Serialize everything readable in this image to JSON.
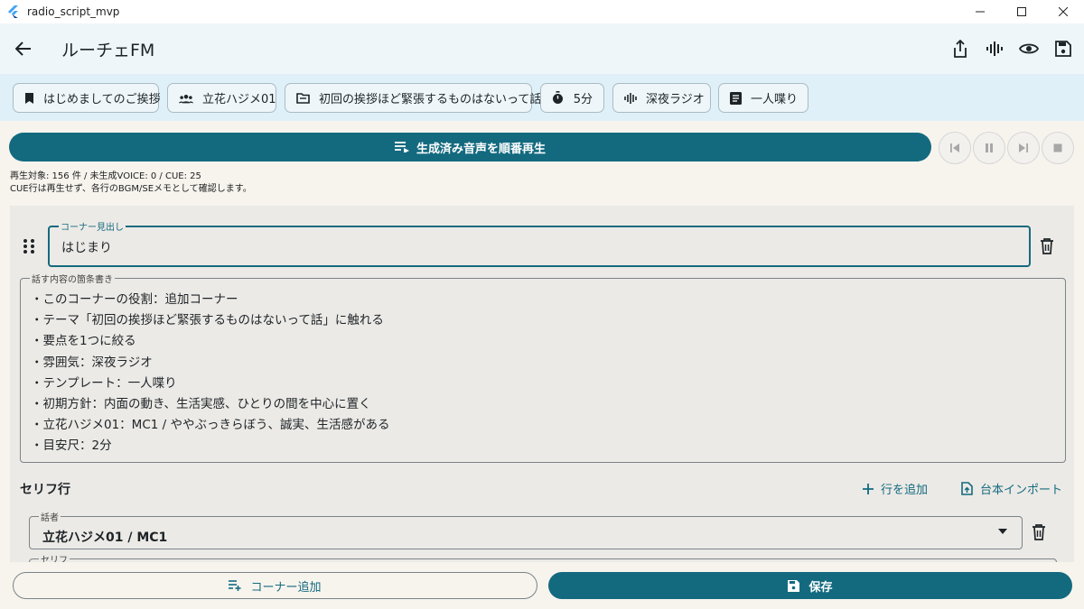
{
  "window": {
    "title": "radio_script_mvp"
  },
  "appbar": {
    "title": "ルーチェFM"
  },
  "chips": [
    {
      "label": "はじめましてのご挨拶",
      "icon": "bookmark-icon"
    },
    {
      "label": "立花ハジメ01",
      "icon": "people-icon"
    },
    {
      "label": "初回の挨拶ほど緊張するものはないって話",
      "icon": "folder-icon"
    },
    {
      "label": "5分",
      "icon": "timer-icon"
    },
    {
      "label": "深夜ラジオ",
      "icon": "waveform-icon"
    },
    {
      "label": "一人喋り",
      "icon": "document-icon"
    }
  ],
  "playback": {
    "play_label": "生成済み音声を順番再生",
    "status_line1": "再生対象: 156 件 / 未生成VOICE: 0 / CUE: 25",
    "status_line2": "CUE行は再生せず、各行のBGM/SEメモとして確認します。"
  },
  "corner": {
    "heading_label": "コーナー見出し",
    "heading_value": "はじまり",
    "notes_label": "話す内容の箇条書き",
    "notes": [
      "・このコーナーの役割：追加コーナー",
      "・テーマ「初回の挨拶ほど緊張するものはないって話」に触れる",
      "・要点を1つに絞る",
      "・雰囲気：深夜ラジオ",
      "・テンプレート：一人喋り",
      "・初期方針：内面の動き、生活実感、ひとりの間を中心に置く",
      "・立花ハジメ01：MC1 / ややぶっきらぼう、誠実、生活感がある",
      "・目安尺：2分"
    ]
  },
  "lines": {
    "section_title": "セリフ行",
    "add_row_label": "行を追加",
    "import_label": "台本インポート",
    "speaker_label": "話者",
    "speaker_value": "立花ハジメ01 / MC1",
    "serif_label": "セリフ"
  },
  "bottom": {
    "add_corner_label": "コーナー追加",
    "save_label": "保存"
  },
  "colors": {
    "accent": "#136a7f",
    "chip_bar": "#dff0f8",
    "app_bar": "#eef6fa"
  }
}
